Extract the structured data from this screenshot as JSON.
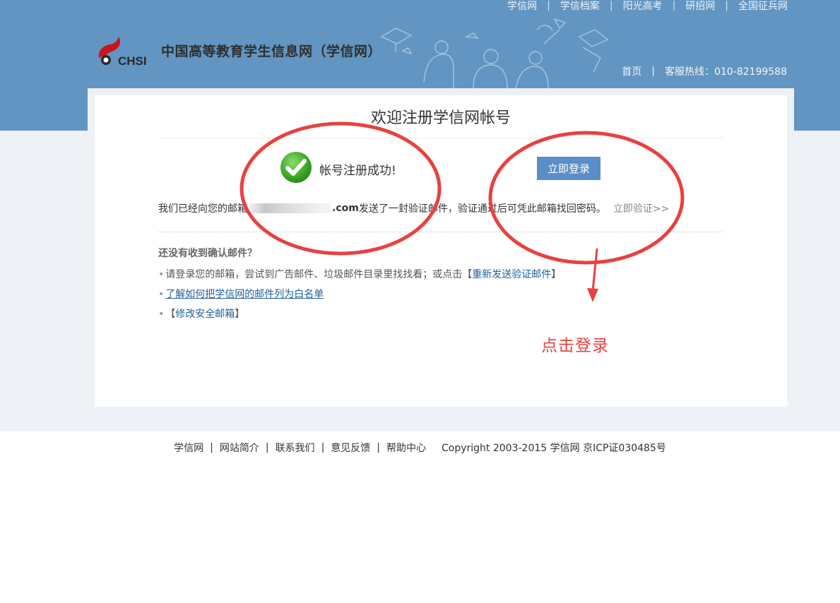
{
  "top_nav": [
    "学信网",
    "学信档案",
    "阳光高考",
    "研招网",
    "全国征兵网"
  ],
  "logo": {
    "abbr": "CHSI",
    "name": "中国高等教育学生信息网（学信网）"
  },
  "sub_nav": {
    "home": "首页",
    "hotline": "客服热线：010-82199588"
  },
  "card": {
    "title": "欢迎注册学信网帐号",
    "success_text": "帐号注册成功!",
    "login_button": "立即登录",
    "sent_prefix": "我们已经向您的邮箱",
    "email_domain": ".com",
    "sent_suffix": " 发送了一封验证邮件，验证通过后可凭此邮箱找回密码。",
    "verify_link": "立即验证>>",
    "help_title": "还没有收到确认邮件？",
    "help_item1_text": "请登录您的邮箱，尝试到广告邮件、垃圾邮件目录里找找看；或点击",
    "help_item1_bracket_open": "【",
    "help_item1_link": "重新发送验证邮件",
    "help_item1_bracket_close": "】",
    "help_item2_link": "了解如何把学信网的邮件列为白名单",
    "help_item3_bracket_open": "【",
    "help_item3_link": "修改安全邮箱",
    "help_item3_bracket_close": "】"
  },
  "annotation": {
    "text": "点击登录",
    "color": "#e8413f"
  },
  "footer": {
    "links": [
      "学信网",
      "网站简介",
      "联系我们",
      "意见反馈",
      "帮助中心"
    ],
    "copyright": "Copyright 2003-2015 学信网  京ICP证030485号"
  },
  "colors": {
    "header": "#6295c1",
    "button": "#5b8ec6",
    "link": "#1f5f99"
  }
}
